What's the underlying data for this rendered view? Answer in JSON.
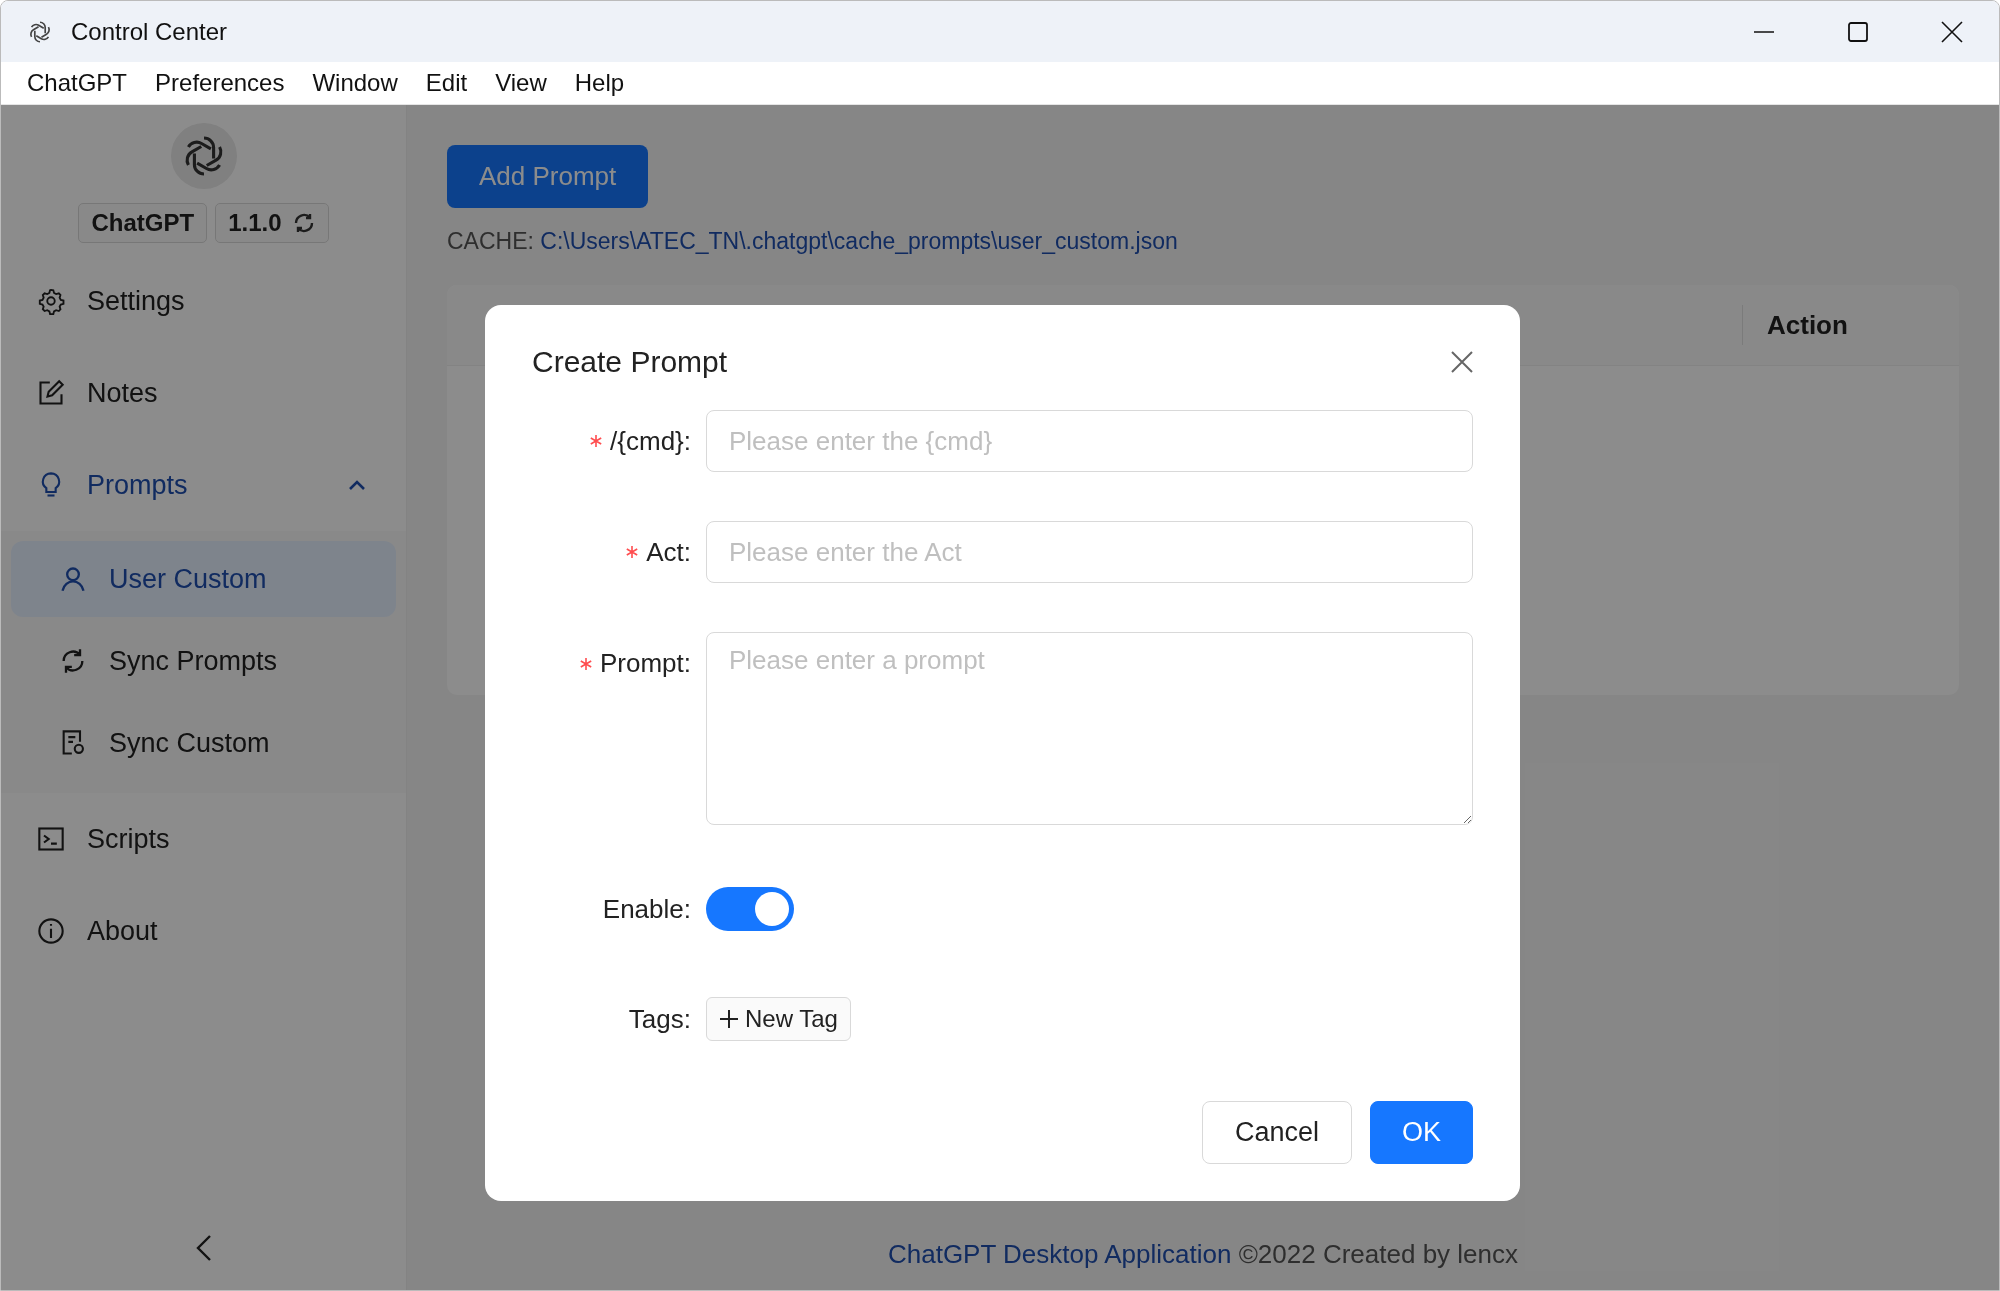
{
  "window": {
    "title": "Control Center"
  },
  "menu_bar": [
    "ChatGPT",
    "Preferences",
    "Window",
    "Edit",
    "View",
    "Help"
  ],
  "sidebar": {
    "app_name": "ChatGPT",
    "version": "1.1.0",
    "items": [
      {
        "label": "Settings",
        "selected": false
      },
      {
        "label": "Notes",
        "selected": false
      },
      {
        "label": "Prompts",
        "selected": false,
        "expanded": true,
        "children": [
          {
            "label": "User Custom",
            "selected": true
          },
          {
            "label": "Sync Prompts",
            "selected": false
          },
          {
            "label": "Sync Custom",
            "selected": false
          }
        ]
      },
      {
        "label": "Scripts",
        "selected": false
      },
      {
        "label": "About",
        "selected": false
      }
    ]
  },
  "main": {
    "add_button": "Add Prompt",
    "cache_label": "CACHE:",
    "cache_path": "C:\\Users\\ATEC_TN\\.chatgpt\\cache_prompts\\user_custom.json",
    "table": {
      "columns": [
        "Action"
      ]
    },
    "footer_link": "ChatGPT Desktop Application",
    "footer_text": "©2022 Created by lencx"
  },
  "dialog": {
    "title": "Create Prompt",
    "fields": [
      {
        "kind": "input",
        "label": "/{cmd}:",
        "required": true,
        "placeholder": "Please enter the {cmd}"
      },
      {
        "kind": "input",
        "label": "Act:",
        "required": true,
        "placeholder": "Please enter the Act"
      },
      {
        "kind": "textarea",
        "label": "Prompt:",
        "required": true,
        "placeholder": "Please enter a prompt"
      },
      {
        "kind": "switch",
        "label": "Enable:",
        "on": true
      },
      {
        "kind": "tags",
        "label": "Tags:",
        "button": "New Tag"
      }
    ],
    "buttons": [
      {
        "label": "Cancel",
        "kind": "default"
      },
      {
        "label": "OK",
        "kind": "primary"
      }
    ]
  }
}
